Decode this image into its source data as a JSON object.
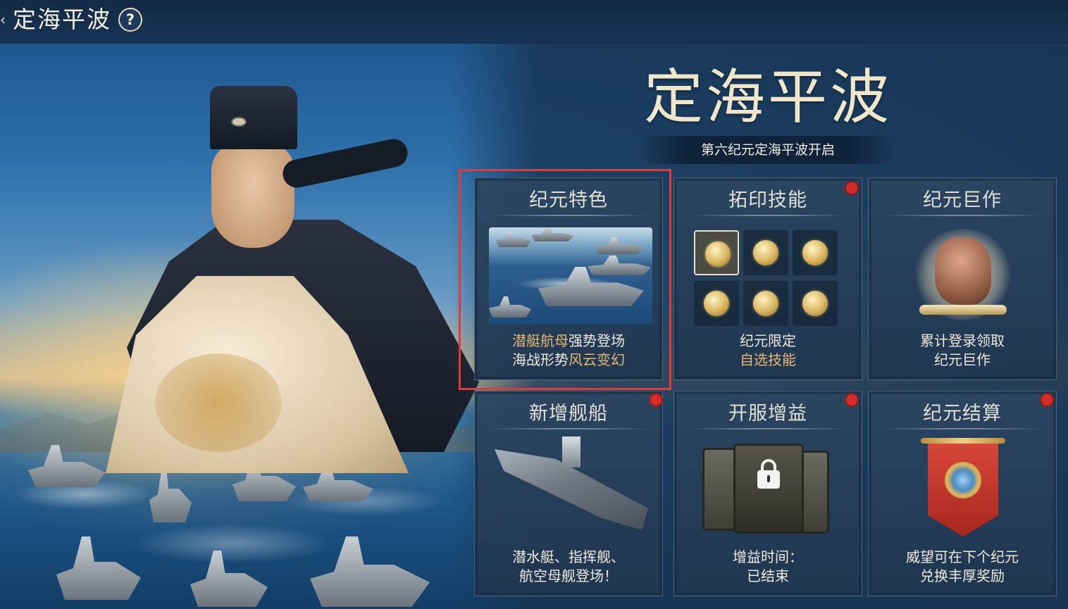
{
  "header": {
    "back_glyph": "‹",
    "title": "定海平波",
    "help_glyph": "?"
  },
  "banner": {
    "title": "定海平波",
    "subtitle": "第六纪元定海平波开启"
  },
  "cards": [
    {
      "title": "纪元特色",
      "desc_line1": [
        {
          "text": "潜艇航母",
          "highlight": true
        },
        {
          "text": "强势登场",
          "highlight": false
        }
      ],
      "desc_line2": [
        {
          "text": "海战形势",
          "highlight": false
        },
        {
          "text": "风云变幻",
          "highlight": true
        }
      ],
      "has_red_dot": false,
      "selected": true
    },
    {
      "title": "拓印技能",
      "desc_line1": [
        {
          "text": "纪元限定",
          "highlight": false
        }
      ],
      "desc_line2": [
        {
          "text": "自选技能",
          "highlight": true
        }
      ],
      "has_red_dot": true
    },
    {
      "title": "纪元巨作",
      "desc_line1": [
        {
          "text": "累计登录领取",
          "highlight": false
        }
      ],
      "desc_line2": [
        {
          "text": "纪元巨作",
          "highlight": false
        }
      ],
      "has_red_dot": false
    },
    {
      "title": "新增舰船",
      "desc_line1": [
        {
          "text": "潜水艇、指挥舰、",
          "highlight": false
        }
      ],
      "desc_line2": [
        {
          "text": "航空母舰登场！",
          "highlight": false
        }
      ],
      "has_red_dot": true
    },
    {
      "title": "开服增益",
      "desc_line1": [
        {
          "text": "增益时间：",
          "highlight": false
        }
      ],
      "desc_line2": [
        {
          "text": "已结束",
          "highlight": false
        }
      ],
      "has_red_dot": true
    },
    {
      "title": "纪元结算",
      "desc_line1": [
        {
          "text": "威望可在下个纪元",
          "highlight": false
        }
      ],
      "desc_line2": [
        {
          "text": "兑换丰厚奖励",
          "highlight": false
        }
      ],
      "has_red_dot": true
    }
  ],
  "icons": {
    "card1": "fleet-image",
    "card2": "skill-coin-grid",
    "card3": "relic-masterpiece",
    "card4": "aircraft-carrier",
    "card5": "locked-cards",
    "card6": "red-banner-emblem"
  },
  "colors": {
    "highlight_text": "#e6b874",
    "red_dot": "#d42c26",
    "selection_border": "#e23a3a"
  }
}
